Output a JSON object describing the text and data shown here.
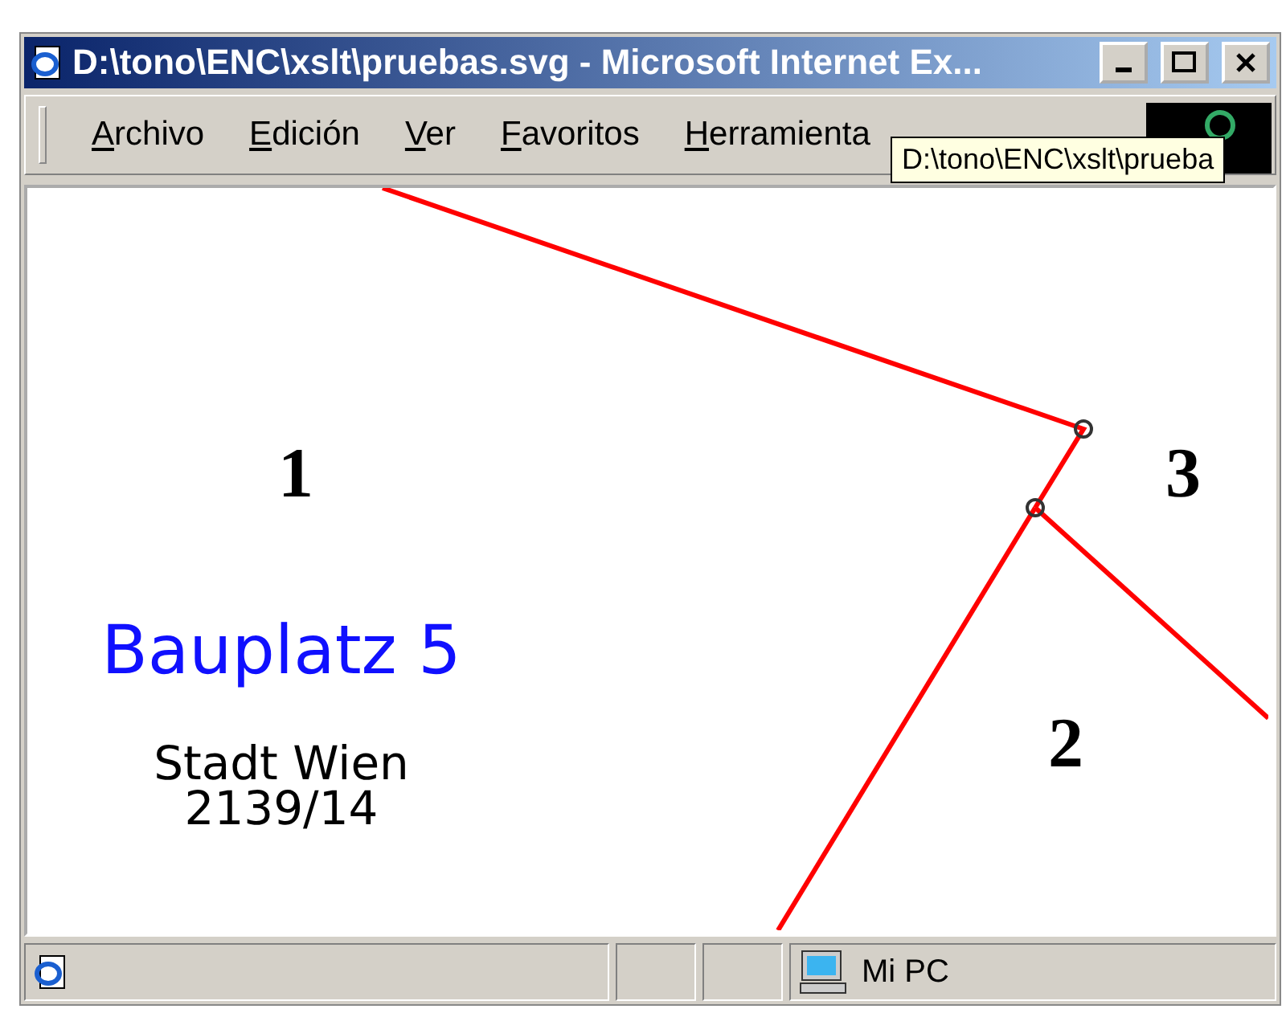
{
  "window": {
    "title": "D:\\tono\\ENC\\xslt\\pruebas.svg - Microsoft Internet Ex..."
  },
  "menu": [
    {
      "accel": "A",
      "rest": "rchivo"
    },
    {
      "accel": "E",
      "rest": "dición"
    },
    {
      "accel": "V",
      "rest": "er"
    },
    {
      "accel": "F",
      "rest": "avoritos"
    },
    {
      "accel": "H",
      "rest": "erramienta"
    }
  ],
  "tooltip": "D:\\tono\\ENC\\xslt\\prueba",
  "map": {
    "parcel_numbers": [
      "1",
      "3",
      "2"
    ],
    "title": "Bauplatz 5",
    "lines": [
      "Stadt Wien",
      "2139/14"
    ]
  },
  "status_bar": {
    "zone": "Mi PC"
  }
}
